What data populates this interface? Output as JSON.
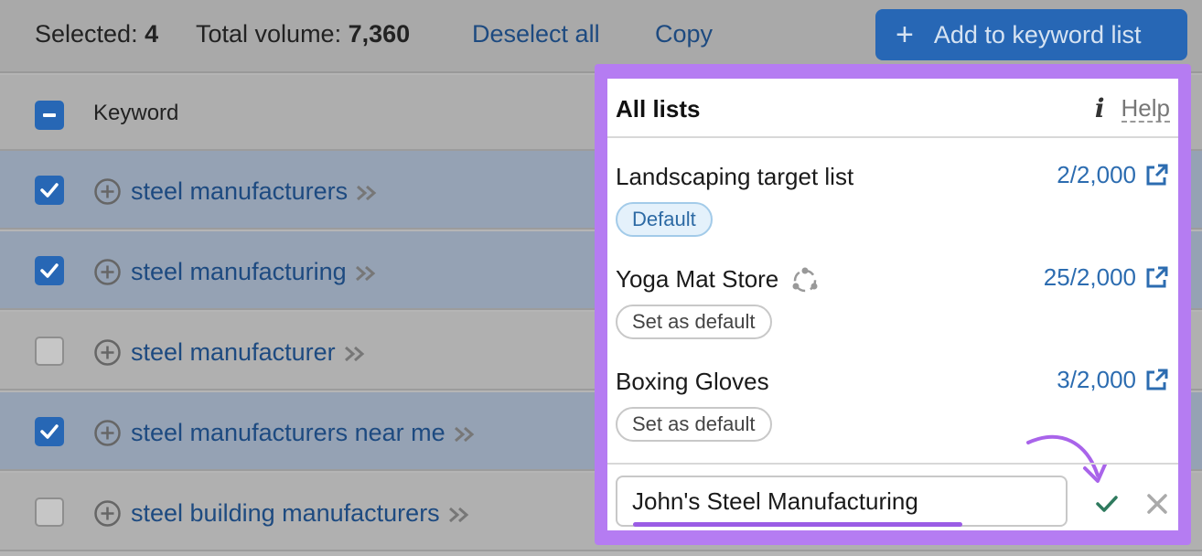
{
  "toolbar": {
    "selected_label": "Selected:",
    "selected_count": "4",
    "volume_label": "Total volume:",
    "volume_value": "7,360",
    "deselect_label": "Deselect all",
    "copy_label": "Copy",
    "add_button_label": "Add to keyword list"
  },
  "table": {
    "header_keyword": "Keyword",
    "rows": [
      {
        "keyword": "steel manufacturers",
        "checked": true
      },
      {
        "keyword": "steel manufacturing",
        "checked": true
      },
      {
        "keyword": "steel manufacturer",
        "checked": false
      },
      {
        "keyword": "steel manufacturers near me",
        "checked": true
      },
      {
        "keyword": "steel building manufacturers",
        "checked": false
      }
    ]
  },
  "popup": {
    "title": "All lists",
    "help_label": "Help",
    "lists": [
      {
        "name": "Landscaping target list",
        "count": "2/2,000",
        "badge": "Default"
      },
      {
        "name": "Yoga Mat Store",
        "count": "25/2,000",
        "badge": "Set as default"
      },
      {
        "name": "Boxing Gloves",
        "count": "3/2,000",
        "badge": "Set as default"
      }
    ],
    "new_list_value": "John's Steel Manufacturing"
  },
  "colors": {
    "accent": "#2767b5",
    "highlight": "#b57cf2",
    "confirm": "#2f7a5e"
  },
  "icons": [
    "plus-icon",
    "checkmark-icon",
    "minus-icon",
    "chevron-double-right-icon",
    "info-icon",
    "external-link-icon",
    "shared-icon",
    "confirm-check-icon",
    "close-icon"
  ]
}
